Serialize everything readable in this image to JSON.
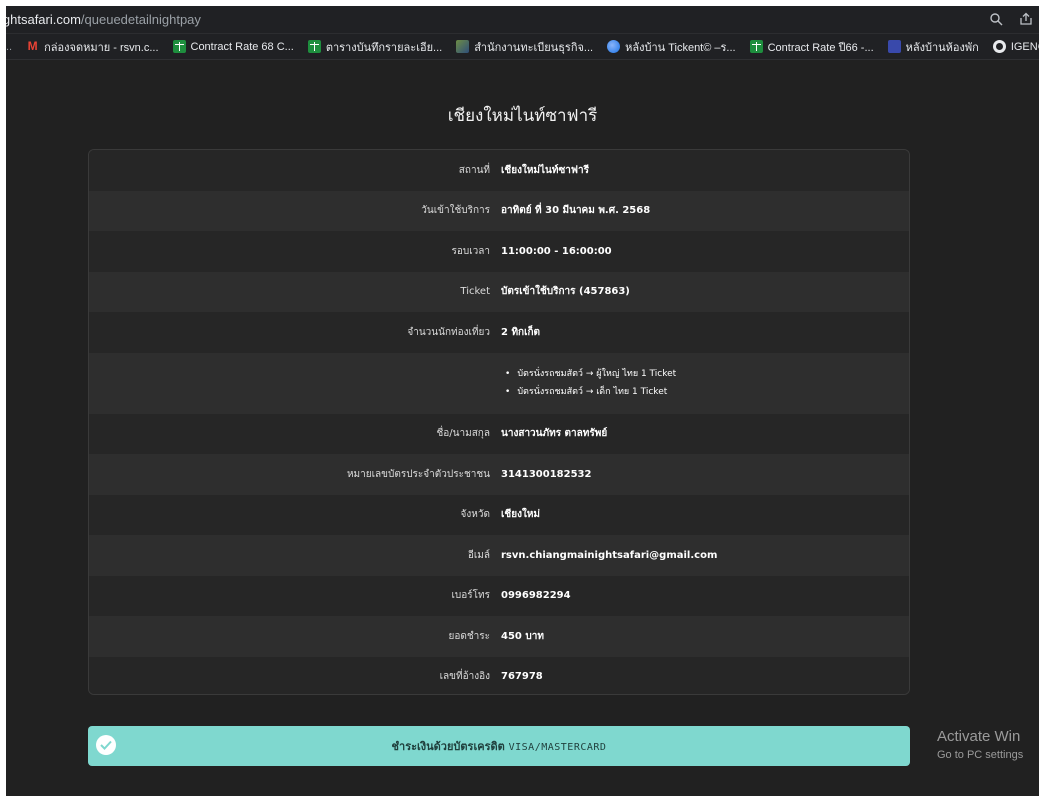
{
  "browser": {
    "url_host": "ightsafari.com",
    "url_path": "/queuedetailnightpay",
    "bookmarks": [
      {
        "icon": "gmail-icon",
        "label": "กล่องจดหมาย - rsvn.c..."
      },
      {
        "icon": "sheets-icon",
        "label": "Contract Rate 68 C..."
      },
      {
        "icon": "sheets-icon",
        "label": "ตารางบันทึกรายละเอีย..."
      },
      {
        "icon": "image-icon",
        "label": "สำนักงานทะเบียนธุรกิจ..."
      },
      {
        "icon": "circle-icon",
        "label": "หลังบ้าน Tickent© –ร..."
      },
      {
        "icon": "sheets-icon",
        "label": "Contract Rate ปี66 -..."
      },
      {
        "icon": "crown-icon",
        "label": "หลังบ้านห้องพัก"
      },
      {
        "icon": "globe-icon",
        "label": "IGENCO workflo"
      }
    ]
  },
  "page": {
    "title": "เชียงใหม่ไนท์ซาฟารี"
  },
  "details": [
    {
      "label": "สถานที่",
      "value": "เชียงใหม่ไนท์ซาฟารี"
    },
    {
      "label": "วันเข้าใช้บริการ",
      "value": "อาทิตย์ ที่ 30 มีนาคม พ.ศ. 2568"
    },
    {
      "label": "รอบเวลา",
      "value": "11:00:00 - 16:00:00"
    },
    {
      "label": "Ticket",
      "value": "บัตรเข้าใช้บริการ (457863)"
    },
    {
      "label": "จำนวนนักท่องเที่ยว",
      "value": "2 ทิกเก็ต"
    },
    {
      "label": "ชื่อ/นามสกุล",
      "value": "นางสาวนภัทร ตาลทรัพย์"
    },
    {
      "label": "หมายเลขบัตรประจำตัวประชาชน",
      "value": "3141300182532"
    },
    {
      "label": "จังหวัด",
      "value": "เชียงใหม่"
    },
    {
      "label": "อีเมล์",
      "value": "rsvn.chiangmainightsafari@gmail.com"
    },
    {
      "label": "เบอร์โทร",
      "value": "0996982294"
    },
    {
      "label": "ยอดชำระ",
      "value": "450 บาท"
    },
    {
      "label": "เลขที่อ้างอิง",
      "value": "767978"
    }
  ],
  "ticket_items": [
    "บัตรนั่งรถชมสัตว์ → ผู้ใหญ่ ไทย 1 Ticket",
    "บัตรนั่งรถชมสัตว์ → เด็ก ไทย 1 Ticket"
  ],
  "payment": {
    "label": "ชำระเงินด้วยบัตรเครดิต",
    "brand": "VISA/MASTERCARD",
    "accent": "#7fd8cf"
  },
  "watermark": {
    "title": "Activate Win",
    "subtitle": "Go to PC settings"
  }
}
